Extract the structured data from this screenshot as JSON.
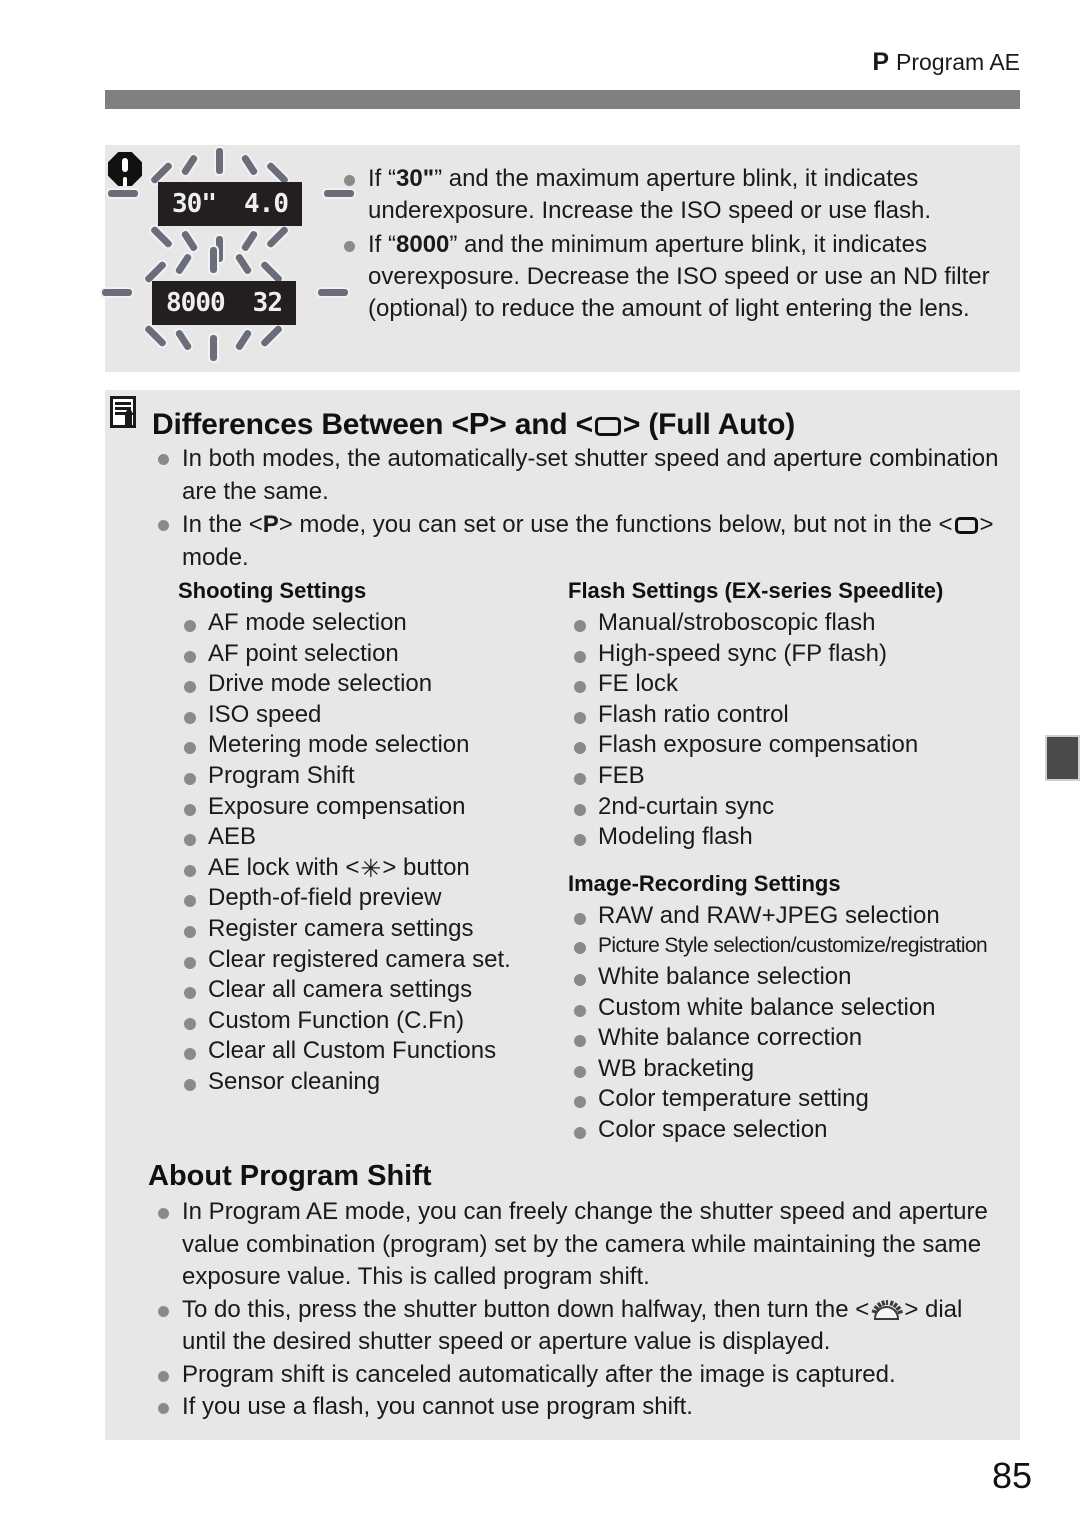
{
  "header": {
    "mode_symbol": "P",
    "title": "Program AE"
  },
  "warning": {
    "icon": "warning-octagon-icon",
    "lcd_displays": [
      {
        "shutter": "30\"",
        "aperture": "4.0",
        "blinking": true
      },
      {
        "shutter": "8000",
        "aperture": "32",
        "blinking": true
      }
    ],
    "items": [
      "If “30\"” and the maximum aperture blink, it indicates underexposure. Increase the ISO speed or use flash.",
      "If “8000” and the minimum aperture blink, it indicates overexposure. Decrease the ISO speed or use an ND filter (optional) to reduce the amount of light entering the lens."
    ],
    "item1_parts": {
      "pre": "If “",
      "bold": "30\"",
      "post": "” and the maximum aperture blink, it indicates underexposure. Increase the ISO speed or use flash."
    },
    "item2_parts": {
      "pre": "If “",
      "bold": "8000",
      "post": "” and the minimum aperture blink, it indicates overexposure. Decrease the ISO speed or use an ND filter (optional) to reduce the amount of light entering the lens."
    }
  },
  "differences": {
    "icon": "note-pencil-icon",
    "title_parts": {
      "a": "Differences Between <",
      "mode_p": "P",
      "b": "> and <",
      "c": "> (Full Auto)"
    },
    "intro": [
      "In both modes, the automatically-set shutter speed and aperture combination are the same.",
      "In the <P> mode, you can set or use the functions below, but not in the <□> mode."
    ],
    "intro2_parts": {
      "a": "In the <",
      "mode_p": "P",
      "b": "> mode, you can set or use the functions below, but not in the <",
      "c": "> mode."
    },
    "columns": {
      "shooting": {
        "heading": "Shooting Settings",
        "items": [
          "AF mode selection",
          "AF point selection",
          "Drive mode selection",
          "ISO speed",
          "Metering mode selection",
          "Program Shift",
          "Exposure compensation",
          "AEB",
          "AE lock with <✳> button",
          "Depth-of-field preview",
          "Register camera settings",
          "Clear registered camera set.",
          "Clear all camera settings",
          "Custom Function (C.Fn)",
          "Clear all Custom Functions",
          "Sensor cleaning"
        ],
        "ae_lock_parts": {
          "a": "AE lock with <",
          "star": "✳",
          "b": "> button"
        }
      },
      "flash": {
        "heading": "Flash Settings (EX-series Speedlite)",
        "items": [
          "Manual/stroboscopic flash",
          "High-speed sync (FP flash)",
          "FE lock",
          "Flash ratio control",
          "Flash exposure compensation",
          "FEB",
          "2nd-curtain sync",
          "Modeling flash"
        ]
      },
      "image_recording": {
        "heading": "Image-Recording Settings",
        "items": [
          "RAW and RAW+JPEG selection",
          "Picture Style selection/customize/registration",
          "White balance selection",
          "Custom white balance selection",
          "White balance correction",
          "WB bracketing",
          "Color temperature setting",
          "Color space selection"
        ]
      }
    }
  },
  "program_shift": {
    "title": "About Program Shift",
    "items": [
      "In Program AE mode, you can freely change the shutter speed and aperture value combination (program) set by the camera while maintaining the same exposure value. This is called program shift.",
      "To do this, press the shutter button down halfway, then turn the <dial> dial until the desired shutter speed or aperture value is displayed.",
      "Program shift is canceled automatically after the image is captured.",
      "If you use a flash, you cannot use program shift."
    ],
    "item2_parts": {
      "a": "To do this, press the shutter button down halfway, then turn the <",
      "b": "> dial until the desired shutter speed or aperture value is displayed."
    }
  },
  "page_number": "85",
  "colors": {
    "note_background": "#e7e7e7",
    "header_rule": "#808080",
    "bullet": "#8a8a8a",
    "lcd_background": "#231f20",
    "edge_tab": "#4a4a4a"
  }
}
